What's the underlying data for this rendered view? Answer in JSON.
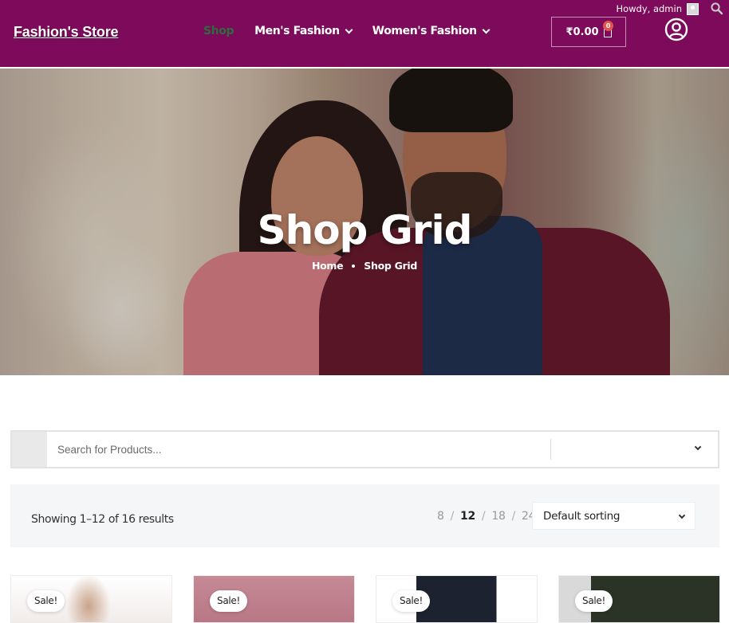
{
  "adminbar": {
    "greeting": "Howdy, admin",
    "avatar_icon": "user-avatar-icon",
    "search_icon": "search-icon"
  },
  "header": {
    "logo": "Fashion's Store",
    "nav": [
      {
        "label": "Shop",
        "active": true
      },
      {
        "label": "Men's Fashion",
        "dropdown": true
      },
      {
        "label": "Women's Fashion",
        "dropdown": true
      }
    ],
    "cart": {
      "total": "₹0.00",
      "count": "0",
      "icon": "shopping-bag-icon"
    },
    "account_icon": "user-circle-icon",
    "colors": {
      "background": "#7d0a5a",
      "active_nav": "#2f6b3f",
      "badge": "#e4544c"
    }
  },
  "hero": {
    "title": "Shop Grid",
    "breadcrumb": {
      "home": "Home",
      "current": "Shop Grid"
    }
  },
  "search": {
    "placeholder": "Search for Products...",
    "category_value": "",
    "dropdown_icon": "chevron-down-icon"
  },
  "toolbar": {
    "result_count": "Showing 1–12 of 16 results",
    "per_page": [
      {
        "value": "8",
        "current": false
      },
      {
        "value": "12",
        "current": true
      },
      {
        "value": "18",
        "current": false
      },
      {
        "value": "24",
        "current": false
      }
    ],
    "separator": "/",
    "sorting": "Default sorting"
  },
  "products": [
    {
      "badge": "Sale!"
    },
    {
      "badge": "Sale!"
    },
    {
      "badge": "Sale!"
    },
    {
      "badge": "Sale!"
    }
  ]
}
